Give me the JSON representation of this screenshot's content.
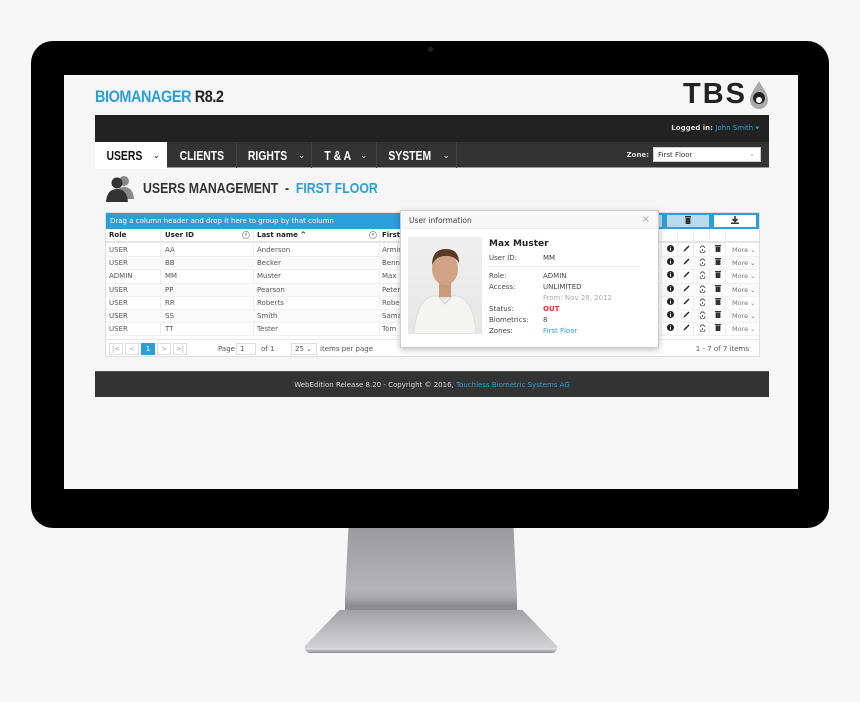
{
  "app": {
    "brand_name": "BIOMANAGER",
    "brand_version": "R8.2",
    "logo_text": "TBS",
    "logged_in_label": "Logged in:",
    "logged_in_user": "John Smith",
    "logged_in_caret": "▾"
  },
  "nav": {
    "items": [
      {
        "label": "USERS",
        "chevron": "⌄",
        "active": true
      },
      {
        "label": "CLIENTS",
        "chevron": "",
        "active": false
      },
      {
        "label": "RIGHTS",
        "chevron": "⌄",
        "active": false
      },
      {
        "label": "T & A",
        "chevron": "⌄",
        "active": false
      },
      {
        "label": "SYSTEM",
        "chevron": "⌄",
        "active": false
      }
    ],
    "zone_label": "Zone:",
    "zone_value": "First Floor",
    "zone_chevron": "⌄"
  },
  "page": {
    "title": "USERS MANAGEMENT",
    "separator": "-",
    "subtitle": "FIRST FLOOR"
  },
  "grid": {
    "group_hint": "Drag a column header and drop it here to group by that column",
    "toolbar_icons": [
      "org-chart-icon",
      "trash-icon",
      "download-icon"
    ],
    "columns": [
      "Role",
      "User ID",
      "Last name ^",
      "First"
    ],
    "rows": [
      {
        "role": "USER",
        "user_id": "AA",
        "last_name": "Anderson",
        "first_name": "Armin",
        "more": "More ⌄"
      },
      {
        "role": "USER",
        "user_id": "BB",
        "last_name": "Becker",
        "first_name": "Benno",
        "more": "More ⌄"
      },
      {
        "role": "ADMIN",
        "user_id": "MM",
        "last_name": "Muster",
        "first_name": "Max",
        "more": "More ⌄"
      },
      {
        "role": "USER",
        "user_id": "PP",
        "last_name": "Pearson",
        "first_name": "Peter",
        "more": "More ⌄"
      },
      {
        "role": "USER",
        "user_id": "RR",
        "last_name": "Roberts",
        "first_name": "Robert",
        "more": "More ⌄"
      },
      {
        "role": "USER",
        "user_id": "SS",
        "last_name": "Smith",
        "first_name": "Samantha",
        "more": "More ⌄"
      },
      {
        "role": "USER",
        "user_id": "TT",
        "last_name": "Tester",
        "first_name": "Tom",
        "more": "More ⌄"
      }
    ],
    "pager": {
      "first": "|<",
      "prev": "<",
      "current_page": "1",
      "next": ">",
      "last": ">|",
      "page_label": "Page",
      "page_value": "1",
      "of_label": "of 1",
      "page_size": "25 ⌄",
      "page_size_label": "items per page",
      "info": "1 - 7 of 7 items"
    }
  },
  "popup": {
    "title": "User information",
    "close": "×",
    "name": "Max Muster",
    "fields": {
      "user_id_label": "User ID:",
      "user_id": "MM",
      "role_label": "Role:",
      "role": "ADMIN",
      "access_label": "Access:",
      "access": "UNLIMITED",
      "access_from": "From: Nov 28, 2012",
      "status_label": "Status:",
      "status": "OUT",
      "biometrics_label": "Biometrics:",
      "biometrics": "8",
      "zones_label": "Zones:",
      "zones": "First Floor"
    }
  },
  "footer": {
    "text": "WebEdition Release 8.20 - Copyright © 2016,",
    "company": "Touchless Biometric Systems AG"
  },
  "colors": {
    "accent": "#2a9fd8",
    "topbar": "#222222",
    "navbar": "#333333",
    "status_out": "#e53030"
  }
}
